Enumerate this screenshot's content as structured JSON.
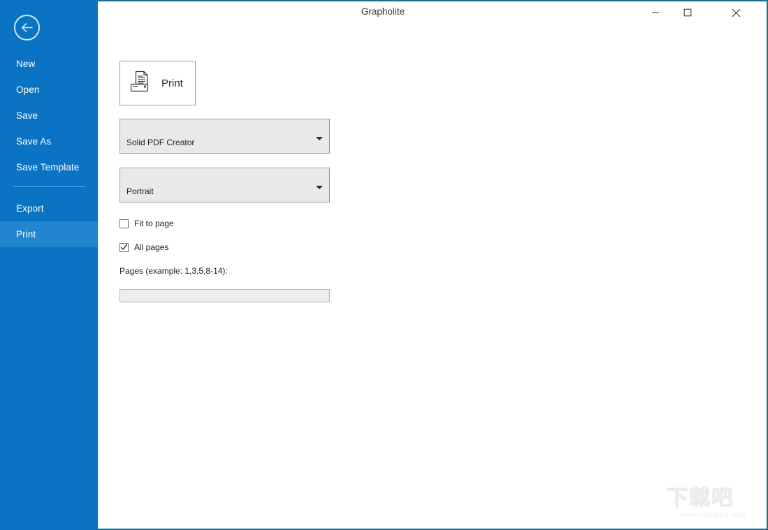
{
  "window": {
    "title": "Grapholite",
    "controls": {
      "minimize": "minimize-button",
      "maximize": "maximize-button",
      "close": "close-button"
    }
  },
  "sidebar": {
    "back_button": "back-arrow",
    "items": [
      {
        "label": "New",
        "selected": false
      },
      {
        "label": "Open",
        "selected": false
      },
      {
        "label": "Save",
        "selected": false
      },
      {
        "label": "Save As",
        "selected": false
      },
      {
        "label": "Save Template",
        "selected": false
      },
      {
        "label": "Export",
        "selected": false
      },
      {
        "label": "Print",
        "selected": true
      }
    ],
    "colors": {
      "background": "#0a73c4",
      "selected": "#2285cf",
      "text": "#ffffff",
      "divider": "#68aee0"
    }
  },
  "main": {
    "print_button": {
      "label": "Print",
      "icon": "printer-icon"
    },
    "printer_select": {
      "value": "Solid PDF Creator",
      "arrow": "chevron-down-icon"
    },
    "orientation_select": {
      "value": "Portrait",
      "arrow": "chevron-down-icon"
    },
    "fit_to_page": {
      "label": "Fit to page",
      "checked": false
    },
    "all_pages": {
      "label": "All pages",
      "checked": true
    },
    "pages": {
      "label": "Pages (example: 1,3,5,8-14):",
      "value": "",
      "placeholder": "",
      "disabled": true
    }
  },
  "watermark": {
    "mark": "下载吧",
    "url": "www.xiazaiba.com"
  },
  "theme": {
    "accent": "#0a73c4",
    "frame_border": "#1d6c8c",
    "control_fill": "#e9e9e9",
    "control_border": "#9e9e9e"
  }
}
